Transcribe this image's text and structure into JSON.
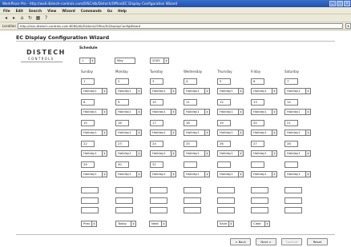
{
  "window": {
    "title": "WorkPlace Pro - http://wall.distech-controls.com/DISC/db/Distech/Office/EC Display Configuration Wizard"
  },
  "menu": [
    "File",
    "Edit",
    "Search",
    "View",
    "Wizard",
    "Commands",
    "Go",
    "Help"
  ],
  "toolbar_icons": [
    "back-icon",
    "forward-icon",
    "home-icon",
    "refresh-icon",
    "grid-icon",
    "help-icon"
  ],
  "location": {
    "label": "Location",
    "value": "http://mac.distech-controls.com:8080/db/Distech/Office/EcDisplayConfigWizard"
  },
  "page": {
    "title": "EC Display Configuration Wizard",
    "logo_main": "DISTECH",
    "logo_sub": "CONTROLS",
    "schedule_label": "Schedule"
  },
  "schedule": {
    "schedule_number": "1",
    "month": "May",
    "year": "2005"
  },
  "days": [
    "Sunday",
    "Monday",
    "Tuesday",
    "Wednesday",
    "Thursday",
    "Friday",
    "Saturday"
  ],
  "holiday_label": "Holiday1",
  "calendar_rows": [
    [
      "1",
      "2",
      "3",
      "4",
      "5",
      "6",
      "7"
    ],
    [
      "8",
      "9",
      "10",
      "11",
      "12",
      "13",
      "14"
    ],
    [
      "15",
      "16",
      "17",
      "18",
      "19",
      "20",
      "21"
    ],
    [
      "22",
      "23",
      "24",
      "25",
      "26",
      "27",
      "28"
    ],
    [
      "29",
      "30",
      "31",
      "",
      "",
      "",
      ""
    ]
  ],
  "nav_selects": {
    "prev": "Prev",
    "today": "Today",
    "next": "Next",
    "save": "Save",
    "clear": "Clear"
  },
  "wizard_buttons": {
    "back": "< Back",
    "next": "Next >",
    "commit": "Commit",
    "reset": "Reset"
  },
  "colors": {
    "titlebar": "#2a5fbf",
    "chrome": "#ece9d8"
  }
}
